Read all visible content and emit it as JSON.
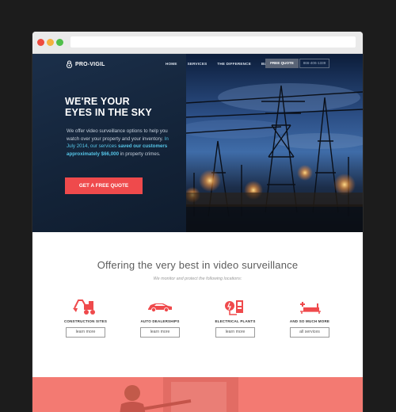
{
  "brand": {
    "name": "PRO-VIGIL"
  },
  "nav": {
    "links": [
      "HOME",
      "SERVICES",
      "THE DIFFERENCE",
      "BLOG"
    ],
    "quote_label": "FREE QUOTE",
    "phone": "866-406-1339"
  },
  "hero": {
    "headline_line1": "WE'RE YOUR",
    "headline_line2": "EYES IN THE SKY",
    "body_part1": "We offer video surveillance options to help you watch over your property and your inventory.",
    "body_part2": " In July 2014, our services ",
    "body_part3": "saved our customers approximately $66,000",
    "body_part4": " in property crimes.",
    "cta_label": "GET A FREE QUOTE"
  },
  "offer": {
    "title": "Offering the very best in video surveillance",
    "subtitle": "We monitor and protect the following locations:",
    "services": [
      {
        "label": "CONSTRUCTION SITES",
        "button": "learn more",
        "icon": "excavator-icon"
      },
      {
        "label": "AUTO DEALERSHIPS",
        "button": "learn more",
        "icon": "car-icon"
      },
      {
        "label": "ELECTRICAL PLANTS",
        "button": "learn more",
        "icon": "electrical-plant-icon"
      },
      {
        "label": "AND SO MUCH MORE",
        "button": "all services",
        "icon": "more-icon"
      }
    ]
  },
  "colors": {
    "accent_red": "#ef4a4c",
    "highlight_blue": "#55c4e6",
    "hero_navy": "#14253c",
    "bottom_band": "#f37a72"
  }
}
